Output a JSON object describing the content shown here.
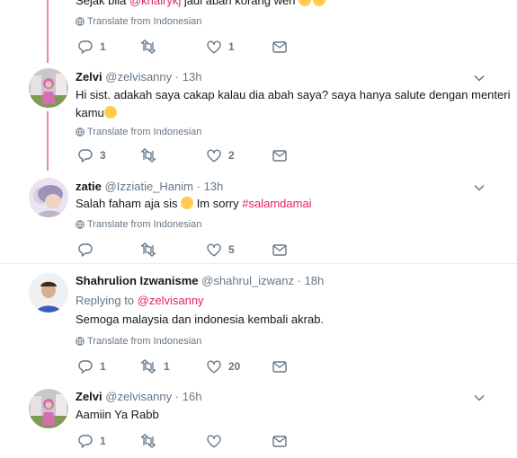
{
  "top_partial": {
    "text_prefix": "Sejak bila ",
    "mention": "@khairykj",
    "text_suffix": " jadi abah korang weh",
    "translate": "Translate from Indonesian",
    "replies": "1",
    "likes": "1"
  },
  "tweets": [
    {
      "name": "Zelvi",
      "handle": "@zelvisanny",
      "time": "13h",
      "line1": "Hi sist. adakah saya cakap kalau dia abah saya? saya hanya salute dengan menteri",
      "line2": "kamu",
      "translate": "Translate from Indonesian",
      "replies": "3",
      "likes": "2"
    },
    {
      "name": "zatie",
      "handle": "@Izziatie_Hanim",
      "time": "13h",
      "text": "Salah faham aja sis ",
      "text_after_emoji": " Im sorry ",
      "hashtag": "#salamdamai",
      "translate": "Translate from Indonesian",
      "likes": "5"
    },
    {
      "name": "Shahrulion Izwanisme",
      "handle": "@shahrul_izwanz",
      "time": "18h",
      "replying_label": "Replying to ",
      "replying_to": "@zelvisanny",
      "text": "Semoga malaysia dan indonesia kembali akrab.",
      "translate": "Translate from Indonesian",
      "replies": "1",
      "retweets": "1",
      "likes": "20"
    },
    {
      "name": "Zelvi",
      "handle": "@zelvisanny",
      "time": "16h",
      "text": "Aamiin Ya Rabb",
      "replies": "1"
    }
  ],
  "separator": "·",
  "colors": {
    "accent": "#e0245e",
    "thread": "#e88b93",
    "muted": "#657786"
  },
  "icons": [
    "reply-icon",
    "retweet-icon",
    "like-icon",
    "dm-icon",
    "globe-icon",
    "caret-down-icon",
    "emoji-icon"
  ]
}
